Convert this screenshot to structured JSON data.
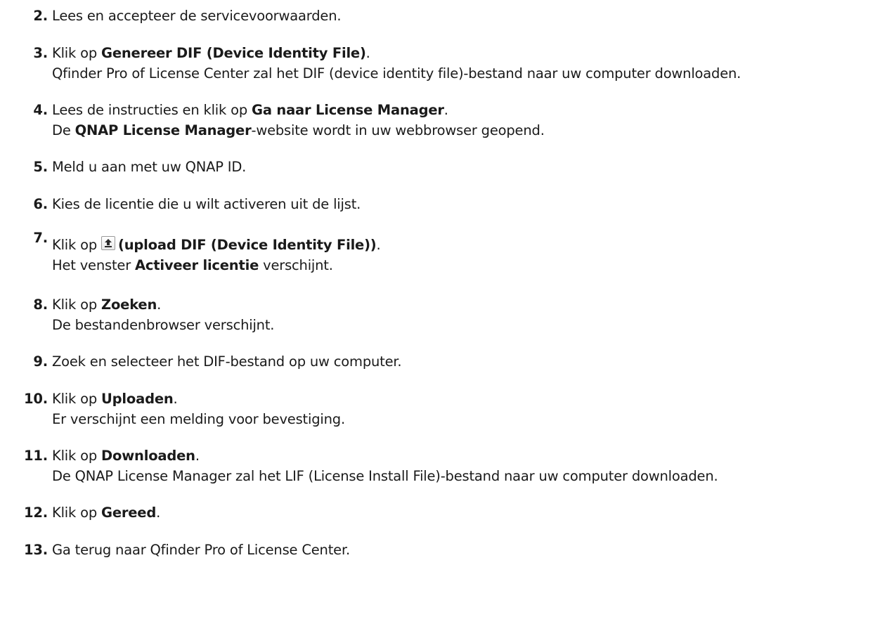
{
  "steps": [
    {
      "num": "2.",
      "parts": [
        "Lees en accepteer de servicevoorwaarden."
      ]
    },
    {
      "num": "3.",
      "parts": [
        "Klik op ",
        "Genereer DIF (Device Identity File)",
        "."
      ],
      "line2": "Qfinder Pro of License Center zal het DIF (device identity file)-bestand naar uw computer downloaden."
    },
    {
      "num": "4.",
      "parts": [
        "Lees de instructies en klik op ",
        "Ga naar License Manager",
        "."
      ],
      "line2_parts": [
        "De ",
        "QNAP License Manager",
        "-website wordt in uw webbrowser geopend."
      ]
    },
    {
      "num": "5.",
      "parts": [
        "Meld u aan met uw QNAP ID."
      ]
    },
    {
      "num": "6.",
      "parts": [
        "Kies de licentie die u wilt activeren uit de lijst."
      ]
    },
    {
      "num": "7.",
      "parts": [
        "Klik op ",
        "(upload DIF (Device Identity File))",
        "."
      ],
      "icon": "upload-icon",
      "line2_parts": [
        "Het venster ",
        "Activeer licentie",
        " verschijnt."
      ]
    },
    {
      "num": "8.",
      "parts": [
        "Klik op ",
        "Zoeken",
        "."
      ],
      "line2": "De bestandenbrowser verschijnt."
    },
    {
      "num": "9.",
      "parts": [
        "Zoek en selecteer het DIF-bestand op uw computer."
      ]
    },
    {
      "num": "10.",
      "parts": [
        "Klik op ",
        "Uploaden",
        "."
      ],
      "line2": "Er verschijnt een melding voor bevestiging."
    },
    {
      "num": "11.",
      "parts": [
        "Klik op ",
        "Downloaden",
        "."
      ],
      "line2": "De QNAP License Manager zal het LIF (License Install File)-bestand naar uw computer downloaden."
    },
    {
      "num": "12.",
      "parts": [
        "Klik op ",
        "Gereed",
        "."
      ]
    },
    {
      "num": "13.",
      "parts": [
        "Ga terug naar Qfinder Pro of License Center."
      ]
    }
  ]
}
